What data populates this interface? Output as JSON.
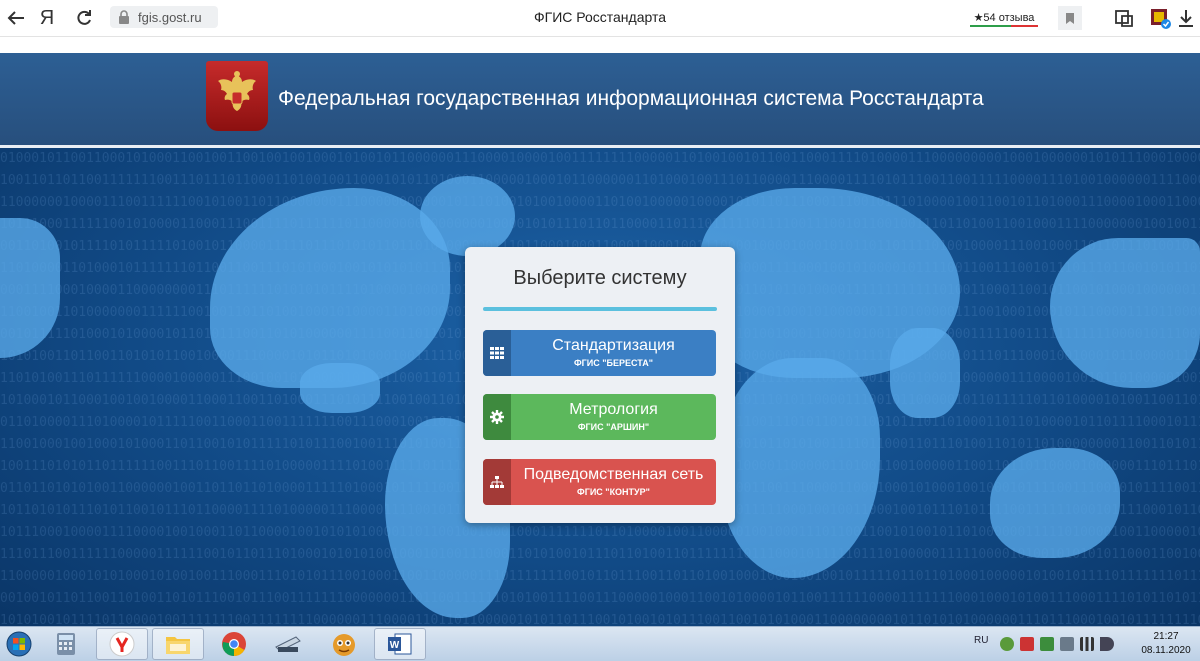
{
  "browser": {
    "address": "fgis.gost.ru",
    "page_title": "ФГИС Росстандарта",
    "reviews": "★54 отзыва",
    "icons": [
      "back-arrow-icon",
      "yandex-icon",
      "reload-icon",
      "lock-icon",
      "bookmark-icon",
      "protect-icon",
      "extension-icon",
      "download-icon"
    ]
  },
  "header": {
    "title": "Федеральная государственная информационная система Росстандарта",
    "emblem": "russian-coat-of-arms"
  },
  "card": {
    "title": "Выберите систему",
    "accent": "#5bc0de",
    "buttons": [
      {
        "label": "Стандартизация",
        "sub": "ФГИС \"БЕРЕСТА\"",
        "icon": "grid-icon",
        "color": "#3b7fc4"
      },
      {
        "label": "Метрология",
        "sub": "ФГИС \"АРШИН\"",
        "icon": "gear-icon",
        "color": "#5cb85c"
      },
      {
        "label": "Подведомственная сеть",
        "sub": "ФГИС \"КОНТУР\"",
        "icon": "sitemap-icon",
        "color": "#d9534f"
      }
    ]
  },
  "taskbar": {
    "lang": "RU",
    "time": "21:27",
    "date": "08.11.2020",
    "apps": [
      "calculator-icon",
      "yandex-browser-icon",
      "explorer-icon",
      "chrome-icon",
      "scanner-icon",
      "game-icon",
      "word-icon"
    ]
  }
}
